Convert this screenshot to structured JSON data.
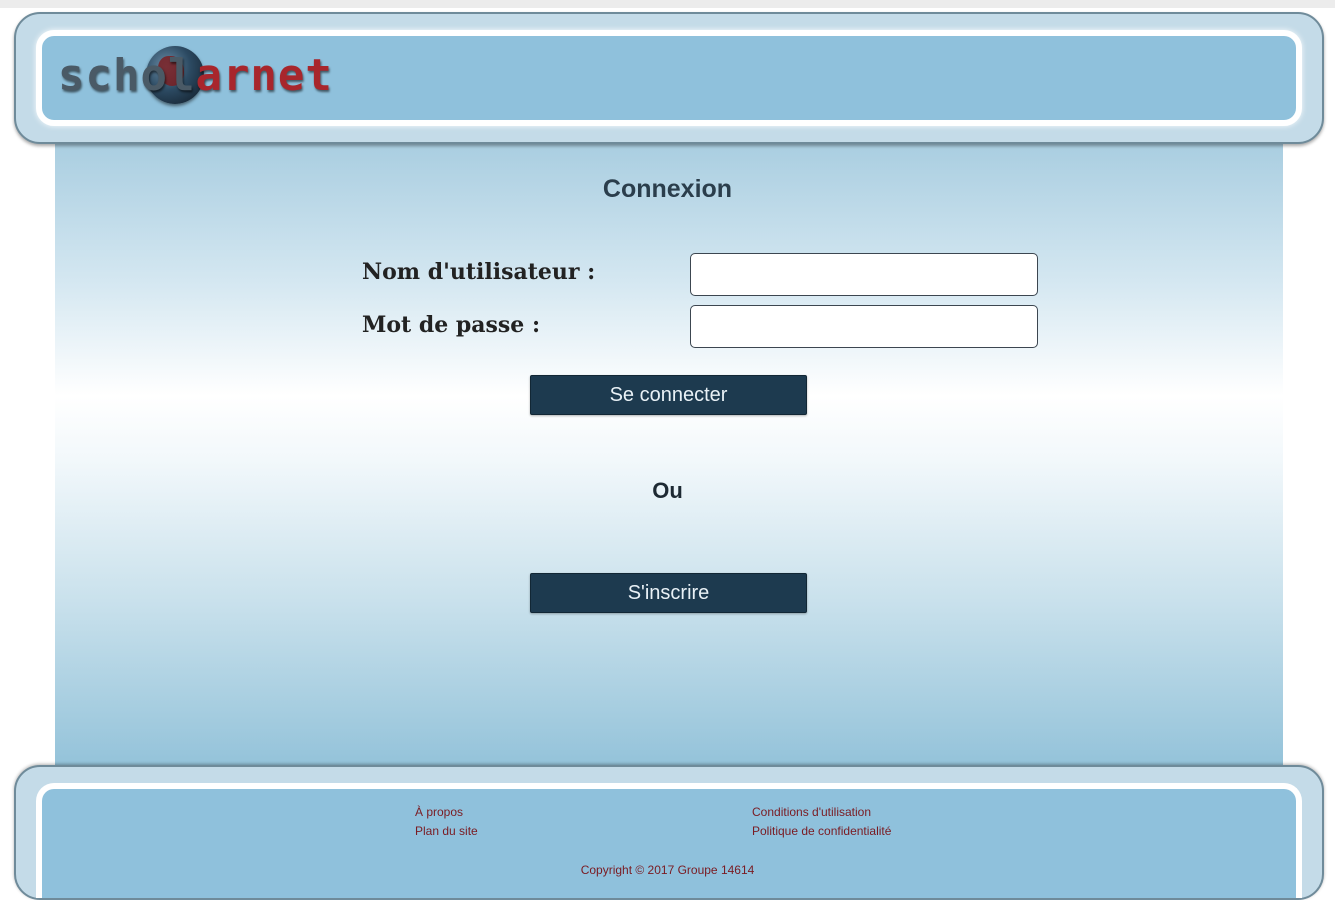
{
  "header": {
    "logo_part1": "schol",
    "logo_part2": "arnet"
  },
  "login": {
    "title": "Connexion",
    "username_label": "Nom d'utilisateur :",
    "username_value": "",
    "password_label": "Mot de passe :",
    "password_value": "",
    "submit_label": "Se connecter",
    "or_text": "Ou",
    "signup_label": "S'inscrire"
  },
  "footer": {
    "links_left": [
      "À propos",
      "Plan du site"
    ],
    "links_right": [
      "Conditions d'utilisation",
      "Politique de confidentialité"
    ],
    "copyright": "Copyright © 2017 Groupe 14614"
  },
  "colors": {
    "button_bg": "#1d3a4f",
    "header_bg": "#8fc1dc",
    "link_color": "#7a1b22"
  }
}
